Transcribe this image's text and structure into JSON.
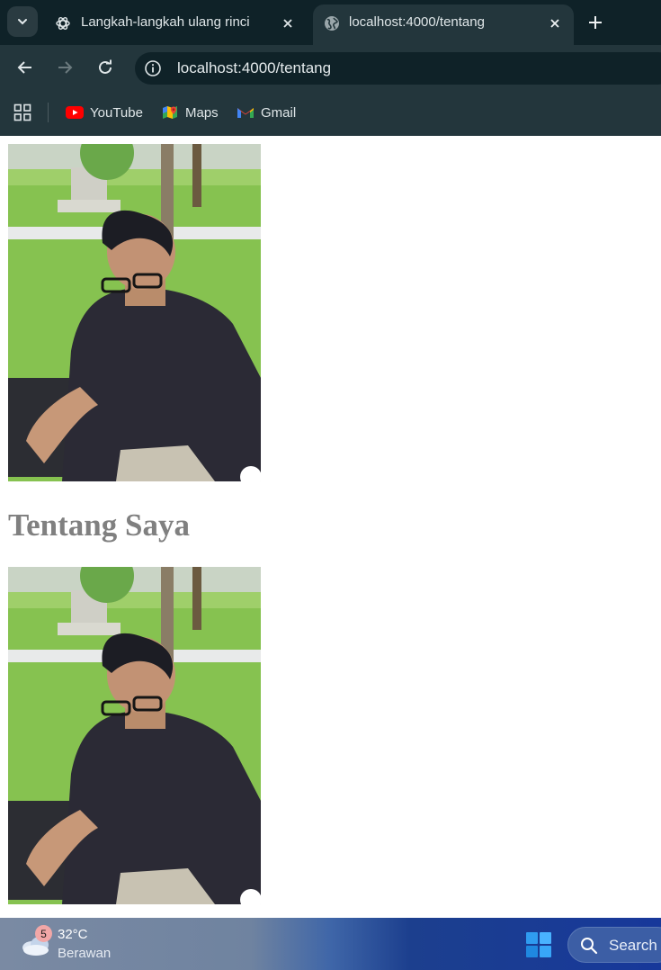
{
  "browser": {
    "tabs": [
      {
        "title": "Langkah-langkah ulang rinci",
        "favicon": "chatgpt-icon",
        "active": false
      },
      {
        "title": "localhost:4000/tentang",
        "favicon": "globe-icon",
        "active": true
      }
    ],
    "address_bar": {
      "url": "localhost:4000/tentang"
    },
    "bookmarks": [
      {
        "label": "YouTube",
        "icon": "youtube-icon"
      },
      {
        "label": "Maps",
        "icon": "maps-icon"
      },
      {
        "label": "Gmail",
        "icon": "gmail-icon"
      }
    ]
  },
  "page": {
    "heading": "Tentang Saya",
    "images": [
      {
        "description": "photo of a young man with glasses and a dark shirt sitting on grass"
      },
      {
        "description": "photo of a young man with glasses and a dark shirt sitting on grass"
      }
    ]
  },
  "taskbar": {
    "weather": {
      "badge": "5",
      "temperature": "32°C",
      "condition": "Berawan"
    },
    "search_label": "Search"
  },
  "colors": {
    "tabbar_bg": "#0f2228",
    "toolbar_bg": "#23363c",
    "heading_color": "#808080",
    "taskbar_accent": "#17389a"
  }
}
